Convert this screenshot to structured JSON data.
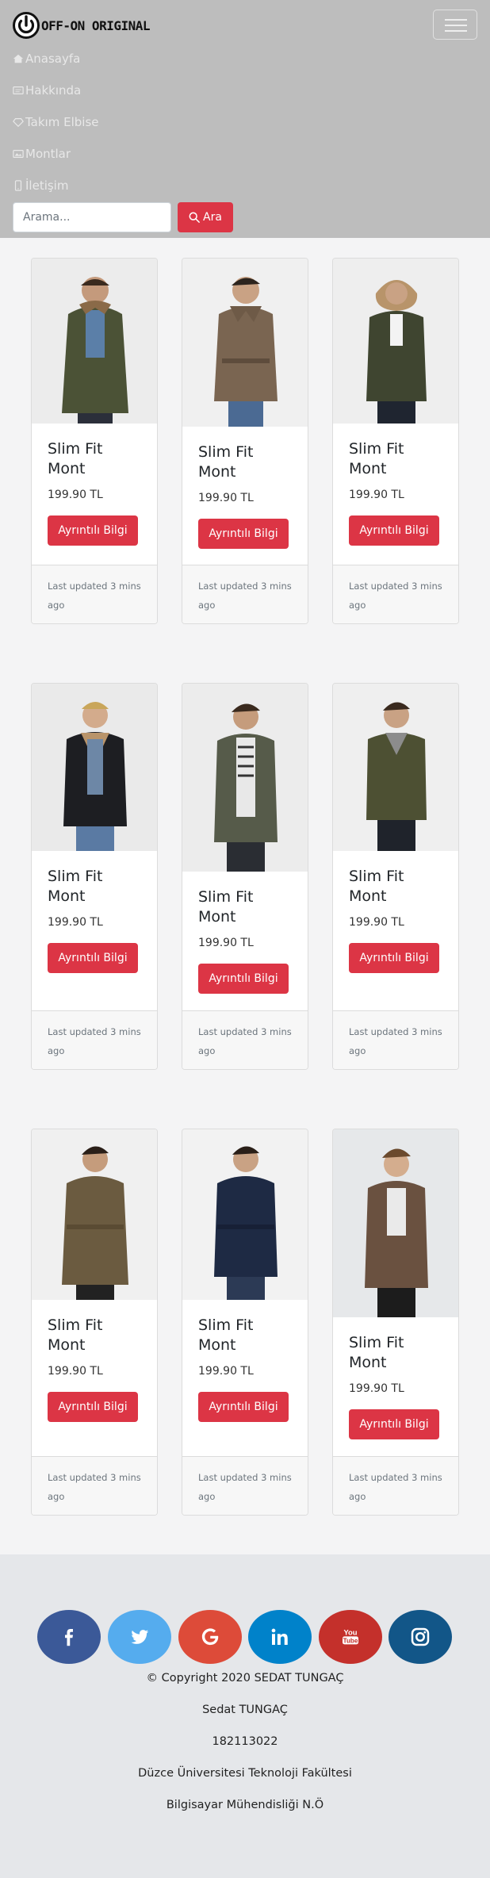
{
  "brand": {
    "name": "OFF-ON ORIGINAL",
    "logo_icon": "power-icon"
  },
  "nav": {
    "items": [
      {
        "label": "Anasayfa",
        "icon": "home-icon"
      },
      {
        "label": "Hakkında",
        "icon": "info-card-icon"
      },
      {
        "label": "Takım Elbise",
        "icon": "diamond-icon"
      },
      {
        "label": "Montlar",
        "icon": "image-icon"
      },
      {
        "label": "İletişim",
        "icon": "phone-icon"
      }
    ]
  },
  "search": {
    "placeholder": "Arama...",
    "button_label": "Ara"
  },
  "products": [
    {
      "title": "Slim Fit Mont",
      "price": "199.90 TL",
      "button": "Ayrıntılı Bilgi",
      "updated": "Last updated 3 mins ago"
    },
    {
      "title": "Slim Fit Mont",
      "price": "199.90 TL",
      "button": "Ayrıntılı Bilgi",
      "updated": "Last updated 3 mins ago"
    },
    {
      "title": "Slim Fit Mont",
      "price": "199.90 TL",
      "button": "Ayrıntılı Bilgi",
      "updated": "Last updated 3 mins ago"
    },
    {
      "title": "Slim Fit Mont",
      "price": "199.90 TL",
      "button": "Ayrıntılı Bilgi",
      "updated": "Last updated 3 mins ago"
    },
    {
      "title": "Slim Fit Mont",
      "price": "199.90 TL",
      "button": "Ayrıntılı Bilgi",
      "updated": "Last updated 3 mins ago"
    },
    {
      "title": "Slim Fit Mont",
      "price": "199.90 TL",
      "button": "Ayrıntılı Bilgi",
      "updated": "Last updated 3 mins ago"
    },
    {
      "title": "Slim Fit Mont",
      "price": "199.90 TL",
      "button": "Ayrıntılı Bilgi",
      "updated": "Last updated 3 mins ago"
    },
    {
      "title": "Slim Fit Mont",
      "price": "199.90 TL",
      "button": "Ayrıntılı Bilgi",
      "updated": "Last updated 3 mins ago"
    },
    {
      "title": "Slim Fit Mont",
      "price": "199.90 TL",
      "button": "Ayrıntılı Bilgi",
      "updated": "Last updated 3 mins ago"
    }
  ],
  "social": [
    {
      "icon": "facebook-icon",
      "color": "#3b5998"
    },
    {
      "icon": "twitter-icon",
      "color": "#55acee"
    },
    {
      "icon": "google-icon",
      "color": "#dd4b39"
    },
    {
      "icon": "linkedin-icon",
      "color": "#0082ca"
    },
    {
      "icon": "youtube-icon",
      "color": "#c4302b"
    },
    {
      "icon": "instagram-icon",
      "color": "#125688"
    }
  ],
  "footer": {
    "copyright": "© Copyright 2020 SEDAT TUNGAÇ",
    "name": "Sedat TUNGAÇ",
    "student_no": "182113022",
    "university": "Düzce Üniversitesi Teknoloji Fakültesi",
    "department": "Bilgisayar Mühendisliği N.Ö"
  },
  "colors": {
    "accent": "#dc3545",
    "header_bg": "#bdbdbd",
    "page_bg": "#f4f4f5",
    "footer_bg": "#e5e7ea"
  }
}
